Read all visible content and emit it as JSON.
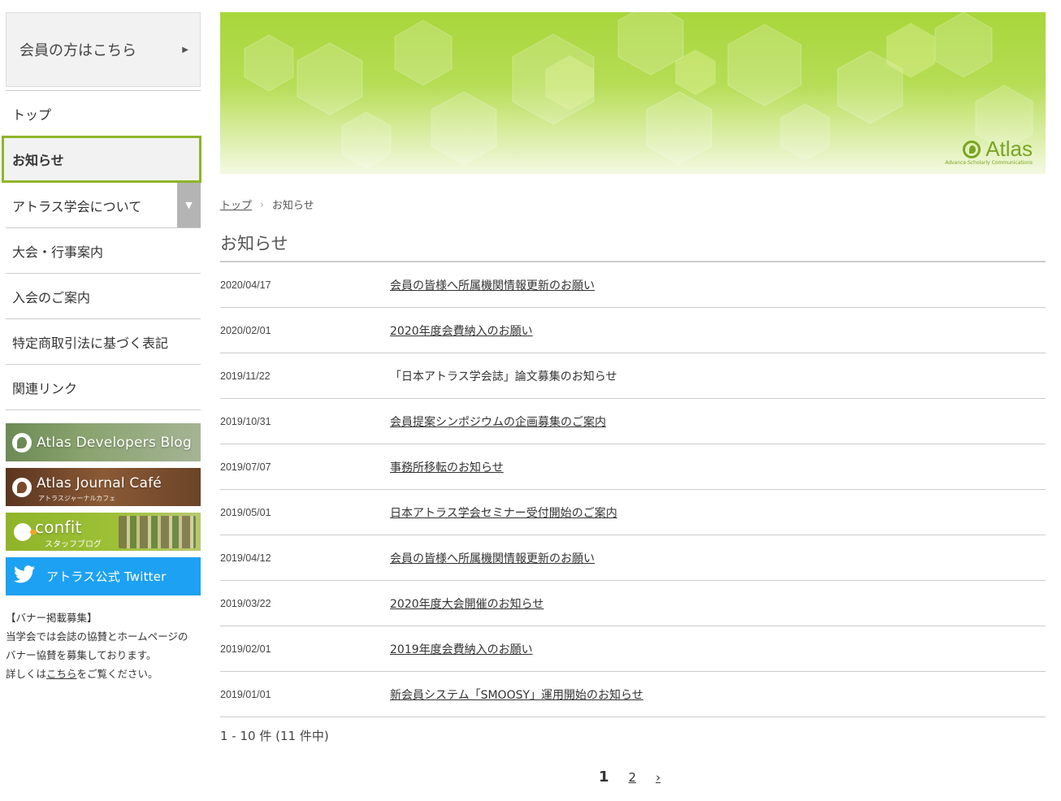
{
  "sidebar": {
    "member_button": "会員の方はこちら",
    "nav": [
      {
        "label": "トップ"
      },
      {
        "label": "お知らせ"
      },
      {
        "label": "アトラス学会について"
      },
      {
        "label": "大会・行事案内"
      },
      {
        "label": "入会のご案内"
      },
      {
        "label": "特定商取引法に基づく表記"
      },
      {
        "label": "関連リンク"
      }
    ],
    "banners": {
      "dev": "Atlas Developers Blog",
      "cafe": "Atlas Journal Café",
      "cafe_sub": "アトラスジャーナルカフェ",
      "confit": "confit",
      "confit_sub": "スタッフブログ",
      "twitter": "アトラス公式 Twitter"
    },
    "recruit": {
      "heading": "【バナー掲載募集】",
      "line1": "当学会では会誌の協賛とホームページの",
      "line2": "バナー協賛を募集しております。",
      "line3_pre": "詳しくは",
      "line3_link": "こちら",
      "line3_post": "をご覧ください。"
    }
  },
  "hero": {
    "brand_name": "Atlas",
    "brand_tagline": "Advance Scholarly Communications"
  },
  "breadcrumb": {
    "home": "トップ",
    "current": "お知らせ"
  },
  "page_title": "お知らせ",
  "news": [
    {
      "date": "2020/04/17",
      "title": "会員の皆様へ所属機関情報更新のお願い"
    },
    {
      "date": "2020/02/01",
      "title": "2020年度会費納入のお願い"
    },
    {
      "date": "2019/11/22",
      "title": "「日本アトラス学会誌」論文募集のお知らせ"
    },
    {
      "date": "2019/10/31",
      "title": "会員提案シンポジウムの企画募集のご案内"
    },
    {
      "date": "2019/07/07",
      "title": "事務所移転のお知らせ"
    },
    {
      "date": "2019/05/01",
      "title": "日本アトラス学会セミナー受付開始のご案内"
    },
    {
      "date": "2019/04/12",
      "title": "会員の皆様へ所属機関情報更新のお願い"
    },
    {
      "date": "2019/03/22",
      "title": "2020年度大会開催のお知らせ"
    },
    {
      "date": "2019/02/01",
      "title": "2019年度会費納入のお願い"
    },
    {
      "date": "2019/01/01",
      "title": "新会員システム「SMOOSY」運用開始のお知らせ"
    }
  ],
  "count_text": "1 - 10 件 (11 件中)",
  "pager": {
    "current": "1",
    "next_page": "2",
    "next_arrow": "›"
  },
  "colors": {
    "accent_green": "#8fb42a",
    "twitter_blue": "#1da1f2"
  }
}
